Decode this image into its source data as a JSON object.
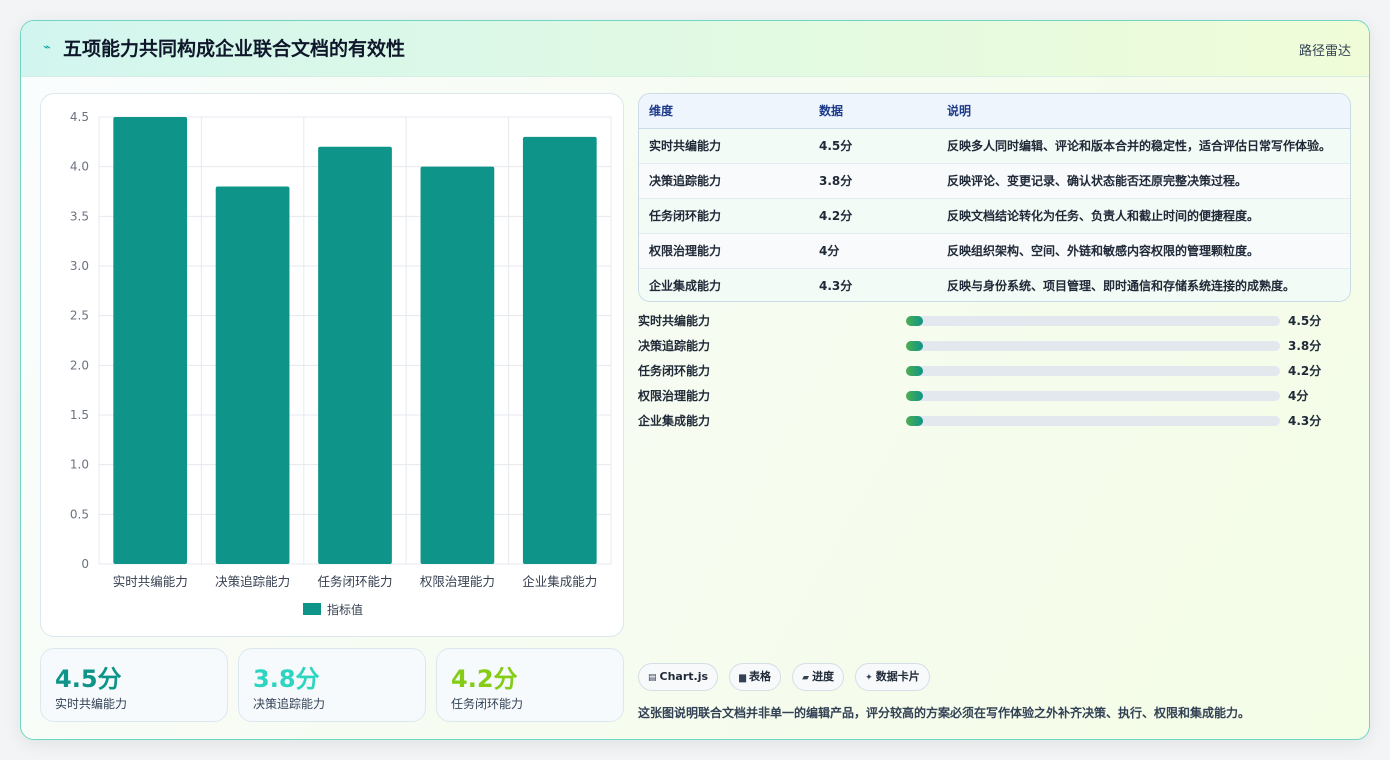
{
  "header": {
    "title": "五项能力共同构成企业联合文档的有效性",
    "tag": "路径雷达",
    "icon": "sparkle-icon"
  },
  "chart_data": {
    "type": "bar",
    "categories": [
      "实时共编能力",
      "决策追踪能力",
      "任务闭环能力",
      "权限治理能力",
      "企业集成能力"
    ],
    "series": [
      {
        "name": "指标值",
        "values": [
          4.5,
          3.8,
          4.2,
          4.0,
          4.3
        ],
        "color": "#0e9488"
      }
    ],
    "ylim": [
      0,
      4.5
    ],
    "yticks": [
      "0",
      "0.5",
      "1.0",
      "1.5",
      "2.0",
      "2.5",
      "3.0",
      "3.5",
      "4.0",
      "4.5"
    ],
    "grid": true,
    "legend": "bottom"
  },
  "kpis": [
    {
      "value": "4.5分",
      "label": "实时共编能力",
      "color": "#0e9488"
    },
    {
      "value": "3.8分",
      "label": "决策追踪能力",
      "color": "#2dd4bf"
    },
    {
      "value": "4.2分",
      "label": "任务闭环能力",
      "color": "#84cc16"
    }
  ],
  "table": {
    "headers": [
      "维度",
      "数据",
      "说明"
    ],
    "rows": [
      [
        "实时共编能力",
        "4.5分",
        "反映多人同时编辑、评论和版本合并的稳定性，适合评估日常写作体验。"
      ],
      [
        "决策追踪能力",
        "3.8分",
        "反映评论、变更记录、确认状态能否还原完整决策过程。"
      ],
      [
        "任务闭环能力",
        "4.2分",
        "反映文档结论转化为任务、负责人和截止时间的便捷程度。"
      ],
      [
        "权限治理能力",
        "4分",
        "反映组织架构、空间、外链和敏感内容权限的管理颗粒度。"
      ],
      [
        "企业集成能力",
        "4.3分",
        "反映与身份系统、项目管理、即时通信和存储系统连接的成熟度。"
      ]
    ]
  },
  "progress": [
    {
      "name": "实时共编能力",
      "value": "4.5分",
      "fraction": 0.045
    },
    {
      "name": "决策追踪能力",
      "value": "3.8分",
      "fraction": 0.045
    },
    {
      "name": "任务闭环能力",
      "value": "4.2分",
      "fraction": 0.045
    },
    {
      "name": "权限治理能力",
      "value": "4分",
      "fraction": 0.045
    },
    {
      "name": "企业集成能力",
      "value": "4.3分",
      "fraction": 0.045
    }
  ],
  "chips": [
    {
      "icon": "chart-icon",
      "glyph": "▤",
      "label": "Chart.js"
    },
    {
      "icon": "table-icon",
      "glyph": "▆",
      "label": "表格"
    },
    {
      "icon": "progress-icon",
      "glyph": "▰",
      "label": "进度"
    },
    {
      "icon": "card-icon",
      "glyph": "✦",
      "label": "数据卡片"
    }
  ],
  "note": "这张图说明联合文档并非单一的编辑产品，评分较高的方案必须在写作体验之外补齐决策、执行、权限和集成能力。"
}
